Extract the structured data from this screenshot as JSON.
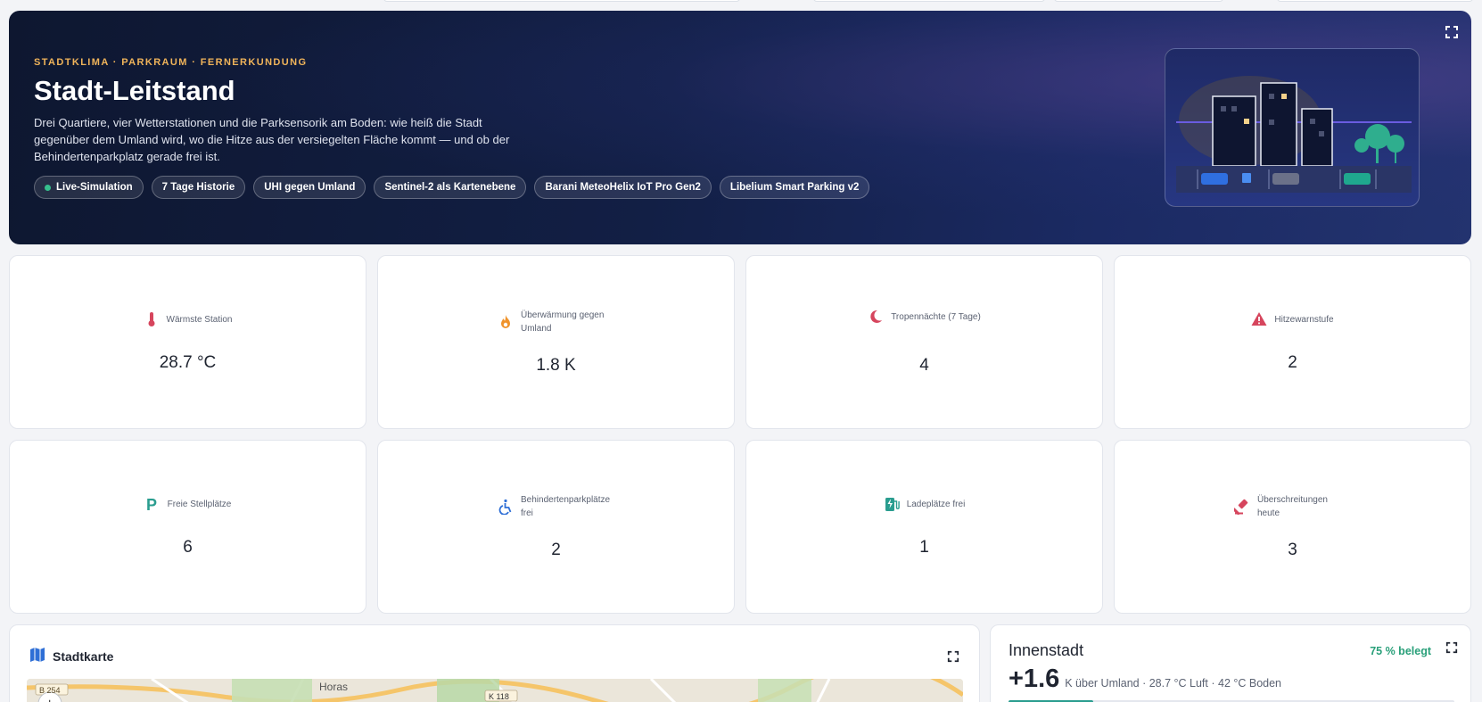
{
  "hero": {
    "kicker": "STADTKLIMA · PARKRAUM · FERNERKUNDUNG",
    "title": "Stadt-Leitstand",
    "description": "Drei Quartiere, vier Wetterstationen und die Parksensorik am Boden: wie heiß die Stadt gegenüber dem Umland wird, wo die Hitze aus der versiegelten Fläche kommt — und ob der Behindertenparkplatz gerade frei ist.",
    "chips": [
      {
        "label": "Live-Simulation",
        "live": true
      },
      {
        "label": "7 Tage Historie"
      },
      {
        "label": "UHI gegen Umland"
      },
      {
        "label": "Sentinel-2 als Kartenebene"
      },
      {
        "label": "Barani MeteoHelix IoT Pro Gen2"
      },
      {
        "label": "Libelium Smart Parking v2"
      }
    ]
  },
  "kpis": [
    {
      "label": "Wärmste Station",
      "value": "28.7 °C",
      "icon": "thermometer-icon",
      "color": "#d6455d"
    },
    {
      "label": "Überwärmung gegen Umland",
      "value": "1.8 K",
      "icon": "flame-icon",
      "color": "#f0932b"
    },
    {
      "label": "Tropennächte (7 Tage)",
      "value": "4",
      "icon": "moon-icon",
      "color": "#d6455d"
    },
    {
      "label": "Hitzewarnstufe",
      "value": "2",
      "icon": "warning-icon",
      "color": "#d6455d"
    },
    {
      "label": "Freie Stellplätze",
      "value": "6",
      "icon": "parking-icon",
      "color": "#2a9d8f"
    },
    {
      "label": "Behindertenparkplätze frei",
      "value": "2",
      "icon": "wheelchair-icon",
      "color": "#2f6fd6"
    },
    {
      "label": "Ladeplätze frei",
      "value": "1",
      "icon": "ev-charger-icon",
      "color": "#2a9d8f"
    },
    {
      "label": "Überschreitungen heute",
      "value": "3",
      "icon": "gavel-icon",
      "color": "#d6455d"
    }
  ],
  "map": {
    "title": "Stadtkarte",
    "labels": [
      "B 254",
      "Horas",
      "K 118"
    ]
  },
  "district": {
    "name": "Innenstadt",
    "occupancy": "75 % belegt",
    "occupancy_fraction": 0.75,
    "uhi_value": "+1.6",
    "summary": "K über Umland · 28.7 °C Luft · 42 °C Boden",
    "bar_fraction": 0.19
  }
}
